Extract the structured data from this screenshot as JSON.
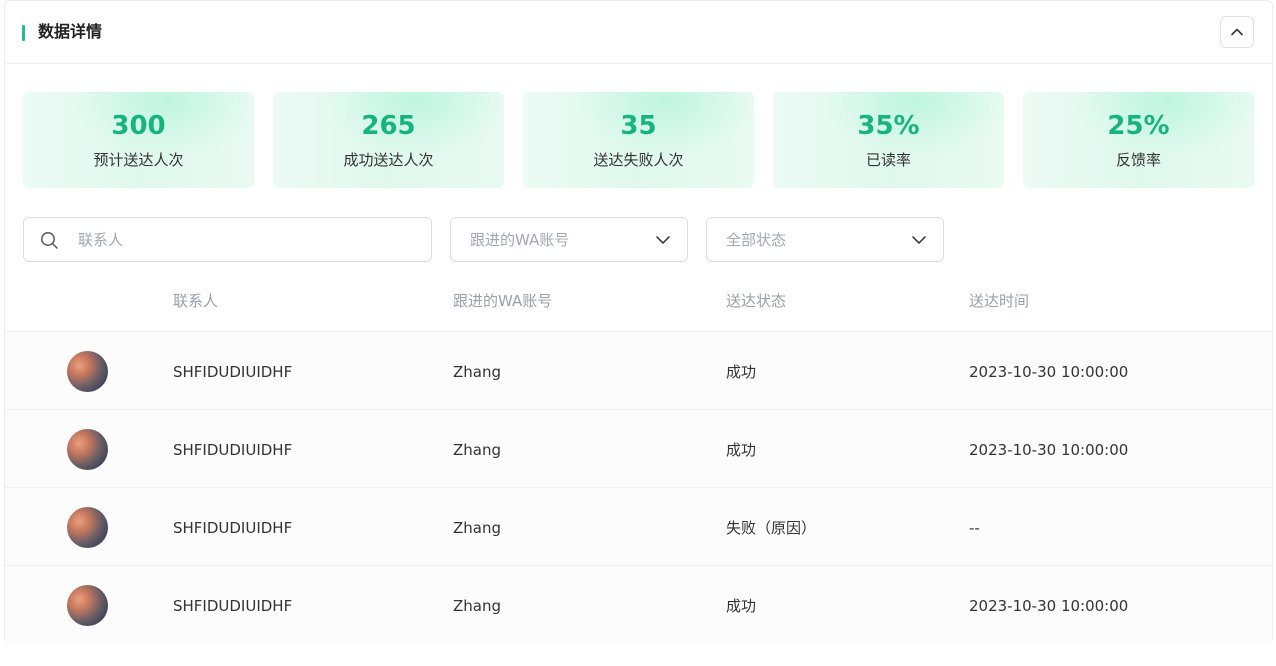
{
  "header": {
    "title": "数据详情"
  },
  "stats": [
    {
      "value": "300",
      "label": "预计送达人次"
    },
    {
      "value": "265",
      "label": "成功送达人次"
    },
    {
      "value": "35",
      "label": "送达失败人次"
    },
    {
      "value": "35%",
      "label": "已读率"
    },
    {
      "value": "25%",
      "label": "反馈率"
    }
  ],
  "filters": {
    "search_placeholder": "联系人",
    "wa_account_placeholder": "跟进的WA账号",
    "status_placeholder": "全部状态"
  },
  "table": {
    "columns": [
      "联系人",
      "跟进的WA账号",
      "送达状态",
      "送达时间"
    ],
    "rows": [
      {
        "contact": "SHFIDUDIUIDHF",
        "wa_account": "Zhang",
        "status": "成功",
        "time": "2023-10-30 10:00:00"
      },
      {
        "contact": "SHFIDUDIUIDHF",
        "wa_account": "Zhang",
        "status": "成功",
        "time": "2023-10-30 10:00:00"
      },
      {
        "contact": "SHFIDUDIUIDHF",
        "wa_account": "Zhang",
        "status": "失败（原因）",
        "time": "--"
      },
      {
        "contact": "SHFIDUDIUIDHF",
        "wa_account": "Zhang",
        "status": "成功",
        "time": "2023-10-30 10:00:00"
      }
    ]
  },
  "icons": {
    "collapse": "chevron-up-icon",
    "search": "search-icon",
    "select": "chevron-down-icon"
  },
  "colors": {
    "accent": "#17b47e",
    "title_bar": "#1fbf86"
  }
}
